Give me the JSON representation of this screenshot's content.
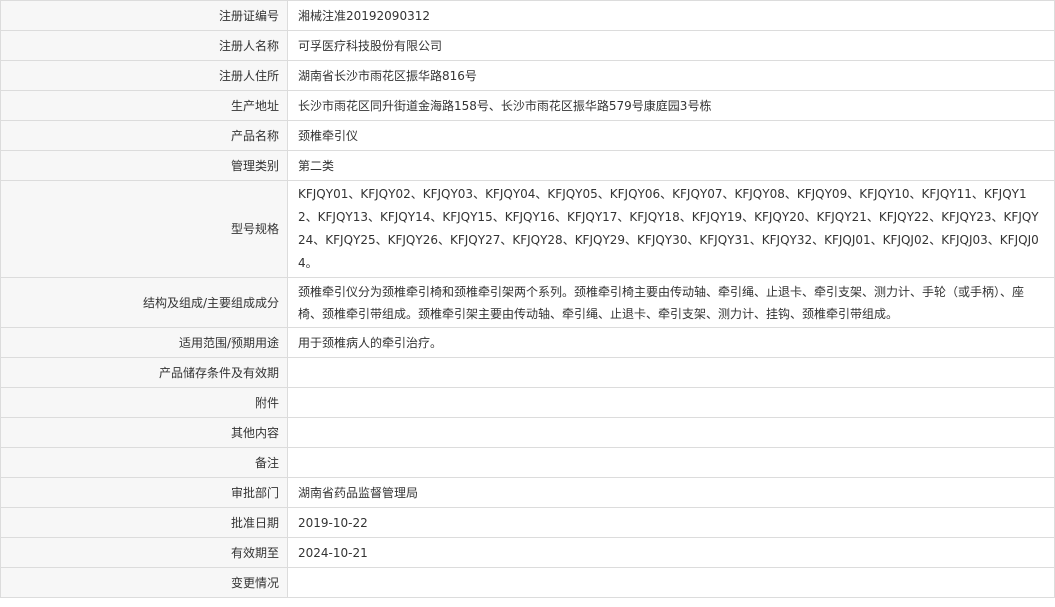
{
  "rows": [
    {
      "label": "注册证编号",
      "value": "湘械注准20192090312"
    },
    {
      "label": "注册人名称",
      "value": "可孚医疗科技股份有限公司"
    },
    {
      "label": "注册人住所",
      "value": "湖南省长沙市雨花区振华路816号"
    },
    {
      "label": "生产地址",
      "value": "长沙市雨花区同升街道金海路158号、长沙市雨花区振华路579号康庭园3号栋"
    },
    {
      "label": "产品名称",
      "value": "颈椎牵引仪"
    },
    {
      "label": "管理类别",
      "value": "第二类"
    },
    {
      "label": "型号规格",
      "value": "KFJQY01、KFJQY02、KFJQY03、KFJQY04、KFJQY05、KFJQY06、KFJQY07、KFJQY08、KFJQY09、KFJQY10、KFJQY11、KFJQY12、KFJQY13、KFJQY14、KFJQY15、KFJQY16、KFJQY17、KFJQY18、KFJQY19、KFJQY20、KFJQY21、KFJQY22、KFJQY23、KFJQY24、KFJQY25、KFJQY26、KFJQY27、KFJQY28、KFJQY29、KFJQY30、KFJQY31、KFJQY32、KFJQJ01、KFJQJ02、KFJQJ03、KFJQJ04。"
    },
    {
      "label": "结构及组成/主要组成成分",
      "value": "颈椎牵引仪分为颈椎牵引椅和颈椎牵引架两个系列。颈椎牵引椅主要由传动轴、牵引绳、止退卡、牵引支架、测力计、手轮（或手柄）、座椅、颈椎牵引带组成。颈椎牵引架主要由传动轴、牵引绳、止退卡、牵引支架、测力计、挂钩、颈椎牵引带组成。"
    },
    {
      "label": "适用范围/预期用途",
      "value": "用于颈椎病人的牵引治疗。"
    },
    {
      "label": "产品储存条件及有效期",
      "value": ""
    },
    {
      "label": "附件",
      "value": ""
    },
    {
      "label": "其他内容",
      "value": ""
    },
    {
      "label": "备注",
      "value": ""
    },
    {
      "label": "审批部门",
      "value": "湖南省药品监督管理局"
    },
    {
      "label": "批准日期",
      "value": "2019-10-22"
    },
    {
      "label": "有效期至",
      "value": "2024-10-21"
    },
    {
      "label": "变更情况",
      "value": ""
    }
  ]
}
